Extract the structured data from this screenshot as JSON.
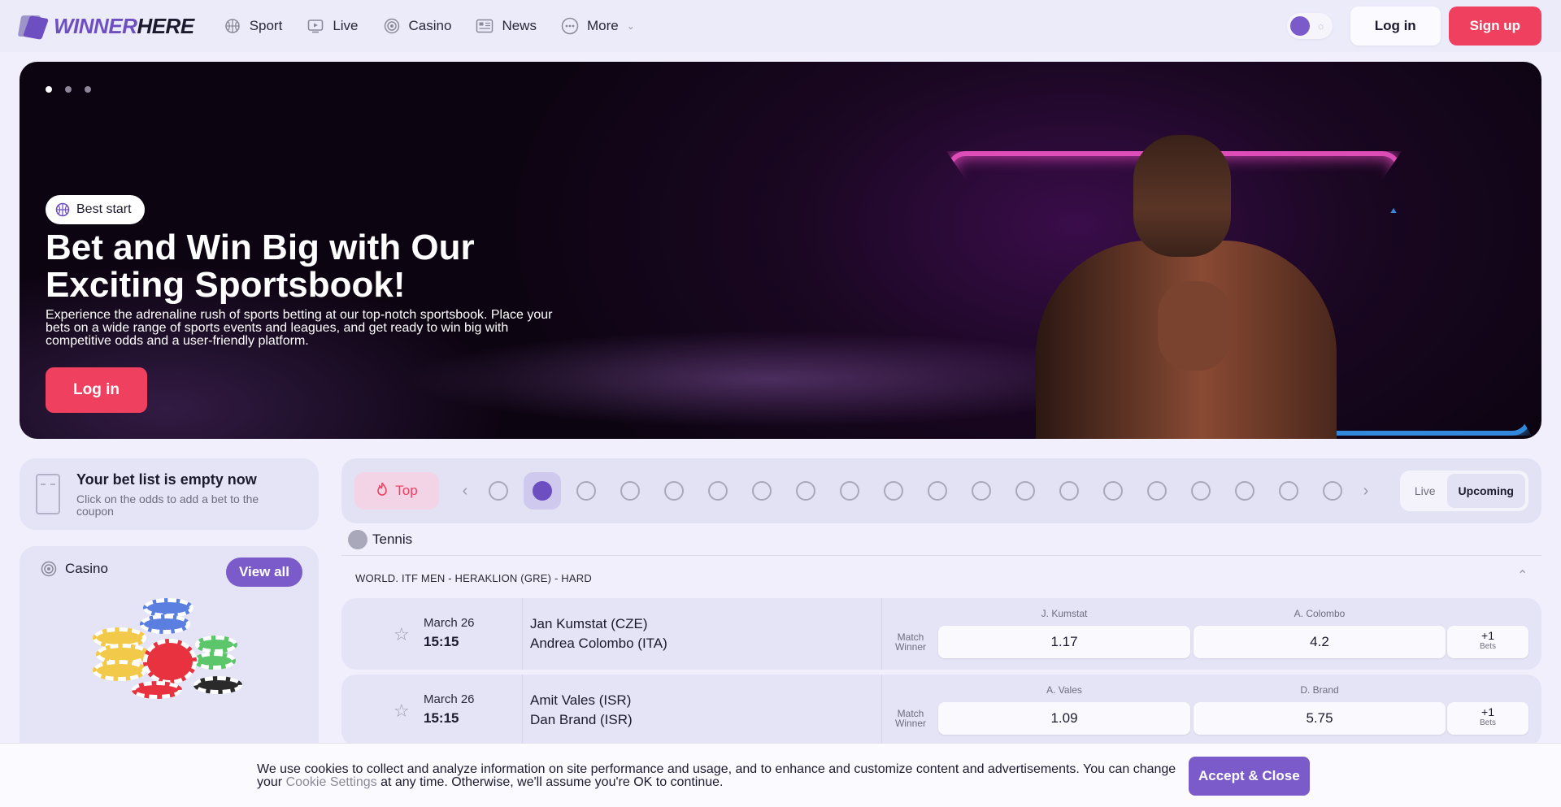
{
  "brand": {
    "part1": "WINNER",
    "part2": "HERE",
    "accent": "#6d4fc2"
  },
  "nav": [
    {
      "label": "Sport",
      "icon": "basketball-icon"
    },
    {
      "label": "Live",
      "icon": "tv-icon"
    },
    {
      "label": "Casino",
      "icon": "casino-chip-icon"
    },
    {
      "label": "News",
      "icon": "newspaper-icon"
    },
    {
      "label": "More",
      "icon": "dots-circle-icon"
    }
  ],
  "header": {
    "login_label": "Log in",
    "signup_label": "Sign up",
    "signup_color": "#f0405f"
  },
  "hero": {
    "badge": "Best start",
    "title": "Bet and Win Big with Our Exciting Sportsbook!",
    "description": "Experience the adrenaline rush of sports betting at our top-notch sportsbook. Place your bets on a wide range of sports events and leagues, and get ready to win big with competitive odds and a user-friendly platform.",
    "button": "Log in",
    "slides_total": 3,
    "active_slide": 1
  },
  "betlist": {
    "title": "Your bet list is empty now",
    "subtitle": "Click on the odds to add a bet to the coupon"
  },
  "casino": {
    "title": "Casino",
    "view_all": "View all"
  },
  "sports_bar": {
    "top_label": "Top",
    "selected_index": 1,
    "icons": [
      "soccer-icon",
      "tennis-icon",
      "basketball-icon",
      "ice-hockey-icon",
      "table-tennis-icon",
      "athletics-icon",
      "volleyball-icon",
      "badminton-icon",
      "baseball-icon",
      "boxing-icon",
      "american-football-helmet-icon",
      "rugby-icon",
      "snooker-icon",
      "darts-icon",
      "american-football-icon",
      "squash-icon",
      "hockey-stick-icon",
      "futsal-icon",
      "beach-soccer-icon",
      "padel-icon"
    ],
    "modes": [
      "Live",
      "Upcoming"
    ],
    "active_mode": "Upcoming"
  },
  "section": {
    "sport": "Tennis",
    "league": "WORLD. ITF MEN - HERAKLION (GRE) - HARD"
  },
  "matches": [
    {
      "date": "March 26",
      "time": "15:15",
      "team1": "Jan Kumstat (CZE)",
      "team2": "Andrea Colombo (ITA)",
      "market": "Match Winner",
      "outcome1": "J. Kumstat",
      "odd1": "1.17",
      "outcome2": "A. Colombo",
      "odd2": "4.2",
      "more": "+1",
      "more_label": "Bets"
    },
    {
      "date": "March 26",
      "time": "15:15",
      "team1": "Amit Vales (ISR)",
      "team2": "Dan Brand (ISR)",
      "market": "Match Winner",
      "outcome1": "A. Vales",
      "odd1": "1.09",
      "outcome2": "D. Brand",
      "odd2": "5.75",
      "more": "+1",
      "more_label": "Bets"
    }
  ],
  "cookie": {
    "text_before": "We use cookies to collect and analyze information on site performance and usage, and to enhance and customize content and advertisements. You can change your ",
    "link": "Cookie Settings",
    "text_after": " at any time. Otherwise, we'll assume you're OK to continue.",
    "button": "Accept & Close"
  }
}
